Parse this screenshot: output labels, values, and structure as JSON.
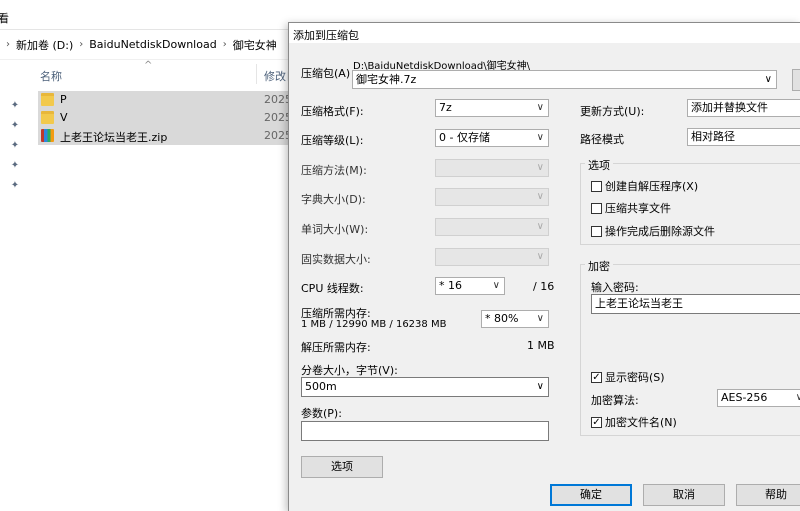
{
  "explorer": {
    "view_label": "看",
    "breadcrumb": [
      "新加卷 (D:)",
      "BaiduNetdiskDownload",
      "御宅女神"
    ],
    "columns": {
      "name": "名称",
      "modified": "修改日"
    },
    "files": [
      {
        "name": "P",
        "date": "2025",
        "type": "folder"
      },
      {
        "name": "V",
        "date": "2025",
        "type": "folder"
      },
      {
        "name": "上老王论坛当老王.zip",
        "date": "2025",
        "type": "zip"
      }
    ]
  },
  "dialog": {
    "title": "添加到压缩包",
    "archive_label": "压缩包(A)",
    "archive_path": "D:\\BaiduNetdiskDownload\\御宅女神\\",
    "archive_name": "御宅女神.7z",
    "format": {
      "label": "压缩格式(F):",
      "value": "7z"
    },
    "level": {
      "label": "压缩等级(L):",
      "value": "0 - 仅存储"
    },
    "method": {
      "label": "压缩方法(M):"
    },
    "dict": {
      "label": "字典大小(D):"
    },
    "word": {
      "label": "单词大小(W):"
    },
    "solid": {
      "label": "固实数据大小:"
    },
    "threads": {
      "label": "CPU 线程数:",
      "value": "* 16",
      "max": "/ 16"
    },
    "mem_compress": {
      "label": "压缩所需内存:",
      "detail": "1 MB / 12990 MB / 16238 MB",
      "value": "* 80%"
    },
    "mem_decompress": {
      "label": "解压所需内存:",
      "value": "1 MB"
    },
    "volume": {
      "label": "分卷大小，字节(V):",
      "value": "500m"
    },
    "params": {
      "label": "参数(P):",
      "value": ""
    },
    "options_button": "选项",
    "update": {
      "label": "更新方式(U):",
      "value": "添加并替换文件"
    },
    "path_mode": {
      "label": "路径模式",
      "value": "相对路径"
    },
    "options_group": {
      "title": "选项",
      "sfx": {
        "label": "创建自解压程序(X)",
        "checked": false
      },
      "shared": {
        "label": "压缩共享文件",
        "checked": false
      },
      "delete": {
        "label": "操作完成后删除源文件",
        "checked": false
      }
    },
    "encrypt_group": {
      "title": "加密",
      "pwd_label": "输入密码:",
      "pwd_value": "上老王论坛当老王",
      "show_pwd": {
        "label": "显示密码(S)",
        "checked": true
      },
      "method_label": "加密算法:",
      "method_value": "AES-256",
      "enc_names": {
        "label": "加密文件名(N)",
        "checked": true
      }
    },
    "buttons": {
      "ok": "确定",
      "cancel": "取消",
      "help": "帮助"
    }
  }
}
